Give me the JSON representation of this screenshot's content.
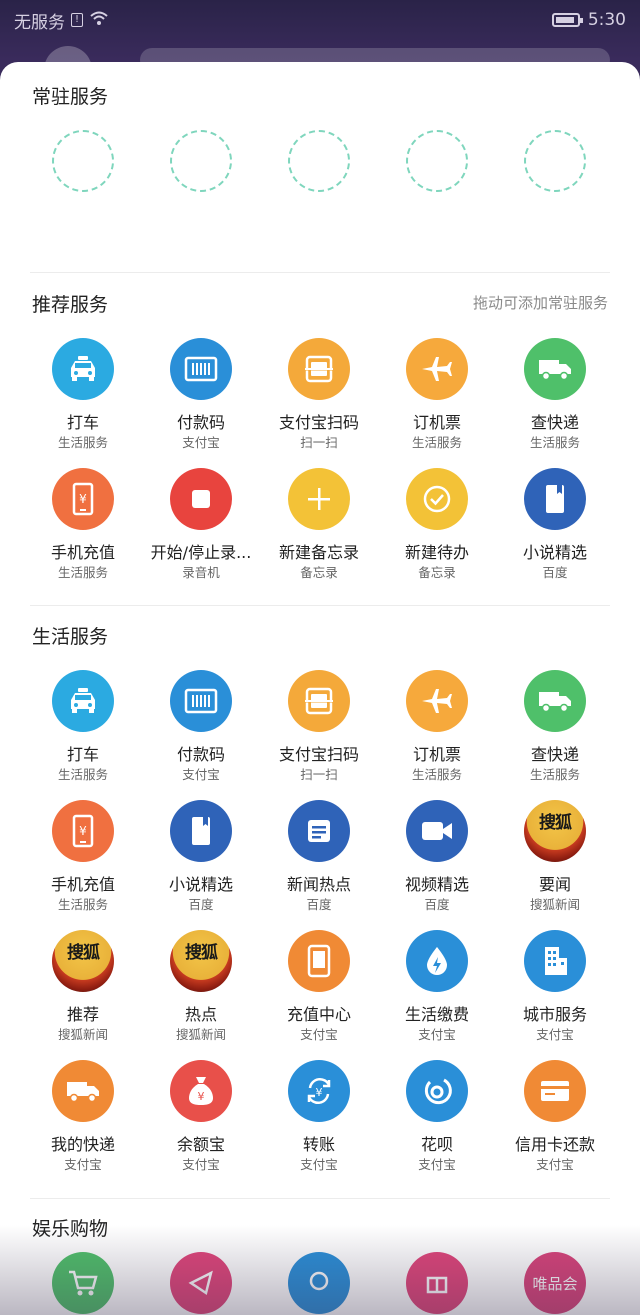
{
  "status_bar": {
    "carrier": "无服务",
    "time": "5:30",
    "alert_icon": "!"
  },
  "colors": {
    "taxi": "#2baae1",
    "pay": "#2a8fd8",
    "scan": "#f4a93a",
    "flight": "#f6a93c",
    "express": "#4fc06a",
    "phone": "#f07040",
    "record": "#e8443e",
    "memo": "#f3c237",
    "todo": "#f3c237",
    "novel": "#2f63b8",
    "news": "#2f63b8",
    "video": "#2f63b8",
    "sohu": "#e9b23a",
    "recharge": "#f08a35",
    "utilities": "#2a8fd8",
    "city": "#2a8fd8",
    "delivery": "#f08a35",
    "yuebao": "#e8504a",
    "transfer": "#2a8fd8",
    "huabei": "#2a8fd8",
    "card": "#f08a35",
    "placeholder_border": "#7fd6bd"
  },
  "sections": {
    "pinned": {
      "title": "常驻服务"
    },
    "recommended": {
      "title": "推荐服务",
      "hint": "拖动可添加常驻服务"
    },
    "life": {
      "title": "生活服务"
    },
    "entertainment": {
      "title": "娱乐购物"
    }
  },
  "recommended_items": [
    {
      "label": "打车",
      "sub": "生活服务",
      "icon": "taxi-icon"
    },
    {
      "label": "付款码",
      "sub": "支付宝",
      "icon": "barcode-icon"
    },
    {
      "label": "支付宝扫码",
      "sub": "扫一扫",
      "icon": "scan-icon"
    },
    {
      "label": "订机票",
      "sub": "生活服务",
      "icon": "airplane-icon"
    },
    {
      "label": "查快递",
      "sub": "生活服务",
      "icon": "truck-icon"
    },
    {
      "label": "手机充值",
      "sub": "生活服务",
      "icon": "phone-recharge-icon"
    },
    {
      "label": "开始/停止录...",
      "sub": "录音机",
      "icon": "stop-record-icon"
    },
    {
      "label": "新建备忘录",
      "sub": "备忘录",
      "icon": "plus-icon"
    },
    {
      "label": "新建待办",
      "sub": "备忘录",
      "icon": "checkmark-icon"
    },
    {
      "label": "小说精选",
      "sub": "百度",
      "icon": "book-icon"
    }
  ],
  "life_items": [
    {
      "label": "打车",
      "sub": "生活服务",
      "icon": "taxi-icon"
    },
    {
      "label": "付款码",
      "sub": "支付宝",
      "icon": "barcode-icon"
    },
    {
      "label": "支付宝扫码",
      "sub": "扫一扫",
      "icon": "scan-icon"
    },
    {
      "label": "订机票",
      "sub": "生活服务",
      "icon": "airplane-icon"
    },
    {
      "label": "查快递",
      "sub": "生活服务",
      "icon": "truck-icon"
    },
    {
      "label": "手机充值",
      "sub": "生活服务",
      "icon": "phone-recharge-icon"
    },
    {
      "label": "小说精选",
      "sub": "百度",
      "icon": "book-icon"
    },
    {
      "label": "新闻热点",
      "sub": "百度",
      "icon": "news-icon"
    },
    {
      "label": "视频精选",
      "sub": "百度",
      "icon": "video-icon"
    },
    {
      "label": "要闻",
      "sub": "搜狐新闻",
      "icon": "sohu-icon"
    },
    {
      "label": "推荐",
      "sub": "搜狐新闻",
      "icon": "sohu-icon"
    },
    {
      "label": "热点",
      "sub": "搜狐新闻",
      "icon": "sohu-icon"
    },
    {
      "label": "充值中心",
      "sub": "支付宝",
      "icon": "tablet-icon"
    },
    {
      "label": "生活缴费",
      "sub": "支付宝",
      "icon": "water-drop-icon"
    },
    {
      "label": "城市服务",
      "sub": "支付宝",
      "icon": "building-icon"
    },
    {
      "label": "我的快递",
      "sub": "支付宝",
      "icon": "delivery-truck-icon"
    },
    {
      "label": "余额宝",
      "sub": "支付宝",
      "icon": "money-bag-icon"
    },
    {
      "label": "转账",
      "sub": "支付宝",
      "icon": "transfer-icon"
    },
    {
      "label": "花呗",
      "sub": "支付宝",
      "icon": "huabei-icon"
    },
    {
      "label": "信用卡还款",
      "sub": "支付宝",
      "icon": "credit-card-icon"
    }
  ],
  "sohu_logo_text": "搜狐",
  "bottom_partial": {
    "vip_text": "唯品会"
  }
}
